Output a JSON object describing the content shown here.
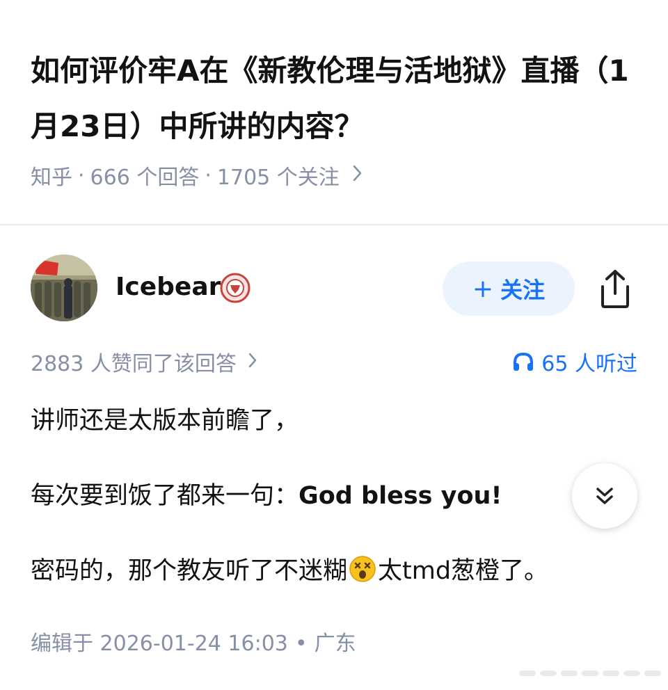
{
  "question": {
    "title": "如何评价牢A在《新教伦理与活地狱》直播（1月23日）中所讲的内容？",
    "source": "知乎",
    "answers": "666 个回答",
    "followers": "1705 个关注"
  },
  "author": {
    "name": "Icebear",
    "badge_icon": "shield-badge-icon",
    "follow_label": "关注"
  },
  "answer": {
    "voteup_text": "2883 人赞同了该回答",
    "listen_text": "65 人听过",
    "paragraphs": {
      "p1": "讲师还是太版本前瞻了，",
      "p2_prefix": "每次要到饭了都来一句：",
      "p2_bold": "God bless you!",
      "p3_prefix": "密码的，那个教友听了不迷糊",
      "p3_suffix": "太tmd葱橙了。"
    },
    "edited_label": "编辑于 2026-01-24 16:03",
    "location": "广东"
  },
  "colors": {
    "accent": "#1772f6",
    "muted": "#8590a6",
    "follow_bg": "#ebf3ff"
  }
}
